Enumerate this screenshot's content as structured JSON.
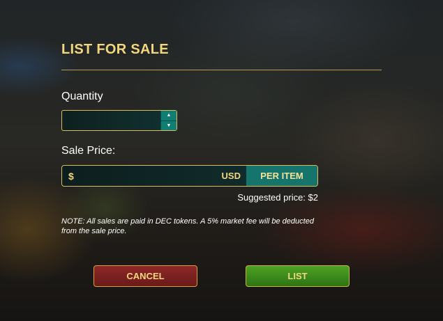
{
  "dialog": {
    "title": "LIST FOR SALE",
    "quantity_label": "Quantity",
    "quantity_value": "",
    "stepper_up_icon": "▲",
    "stepper_down_icon": "▼",
    "sale_price_label": "Sale Price:",
    "currency_symbol": "$",
    "price_value": "",
    "currency_code": "USD",
    "per_item_label": "PER ITEM",
    "suggested_price": "Suggested price: $2",
    "note": "NOTE: All sales are paid in DEC tokens. A 5% market fee will be deducted from the sale price.",
    "cancel_label": "CANCEL",
    "list_label": "LIST"
  },
  "colors": {
    "accent_gold": "#f3d77e",
    "cancel_red": "#8e2727",
    "list_green": "#4ea222",
    "teal": "#15756c"
  }
}
